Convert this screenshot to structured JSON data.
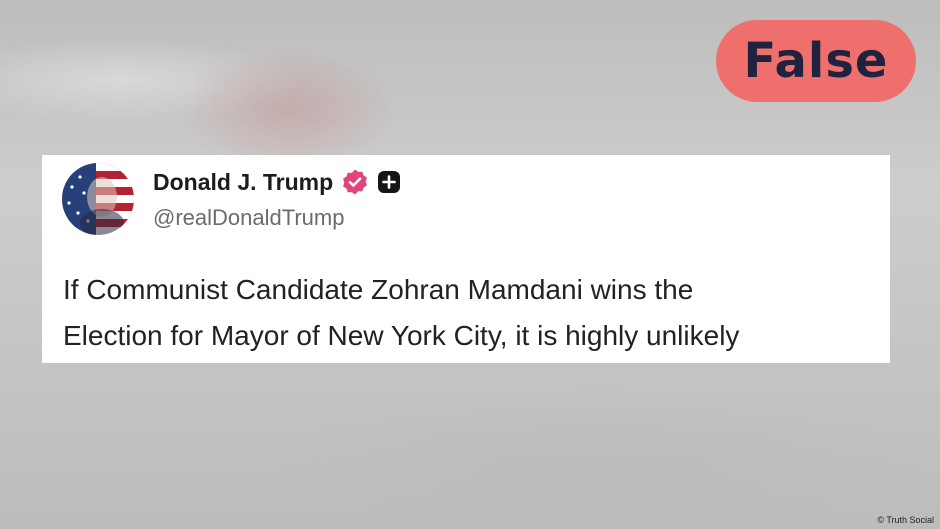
{
  "verdict": {
    "label": "False",
    "color": "#ef6f6c"
  },
  "post": {
    "author_name": "Donald J. Trump",
    "handle": "@realDonaldTrump",
    "verified_icon": "verified-badge-icon",
    "plus_icon": "plus-badge-icon",
    "avatar_icon": "profile-avatar-icon",
    "text_lines": [
      "If Communist Candidate Zohran Mamdani wins the",
      "Election for Mayor of New York City, it is highly unlikely"
    ]
  },
  "credit": "© Truth Social"
}
